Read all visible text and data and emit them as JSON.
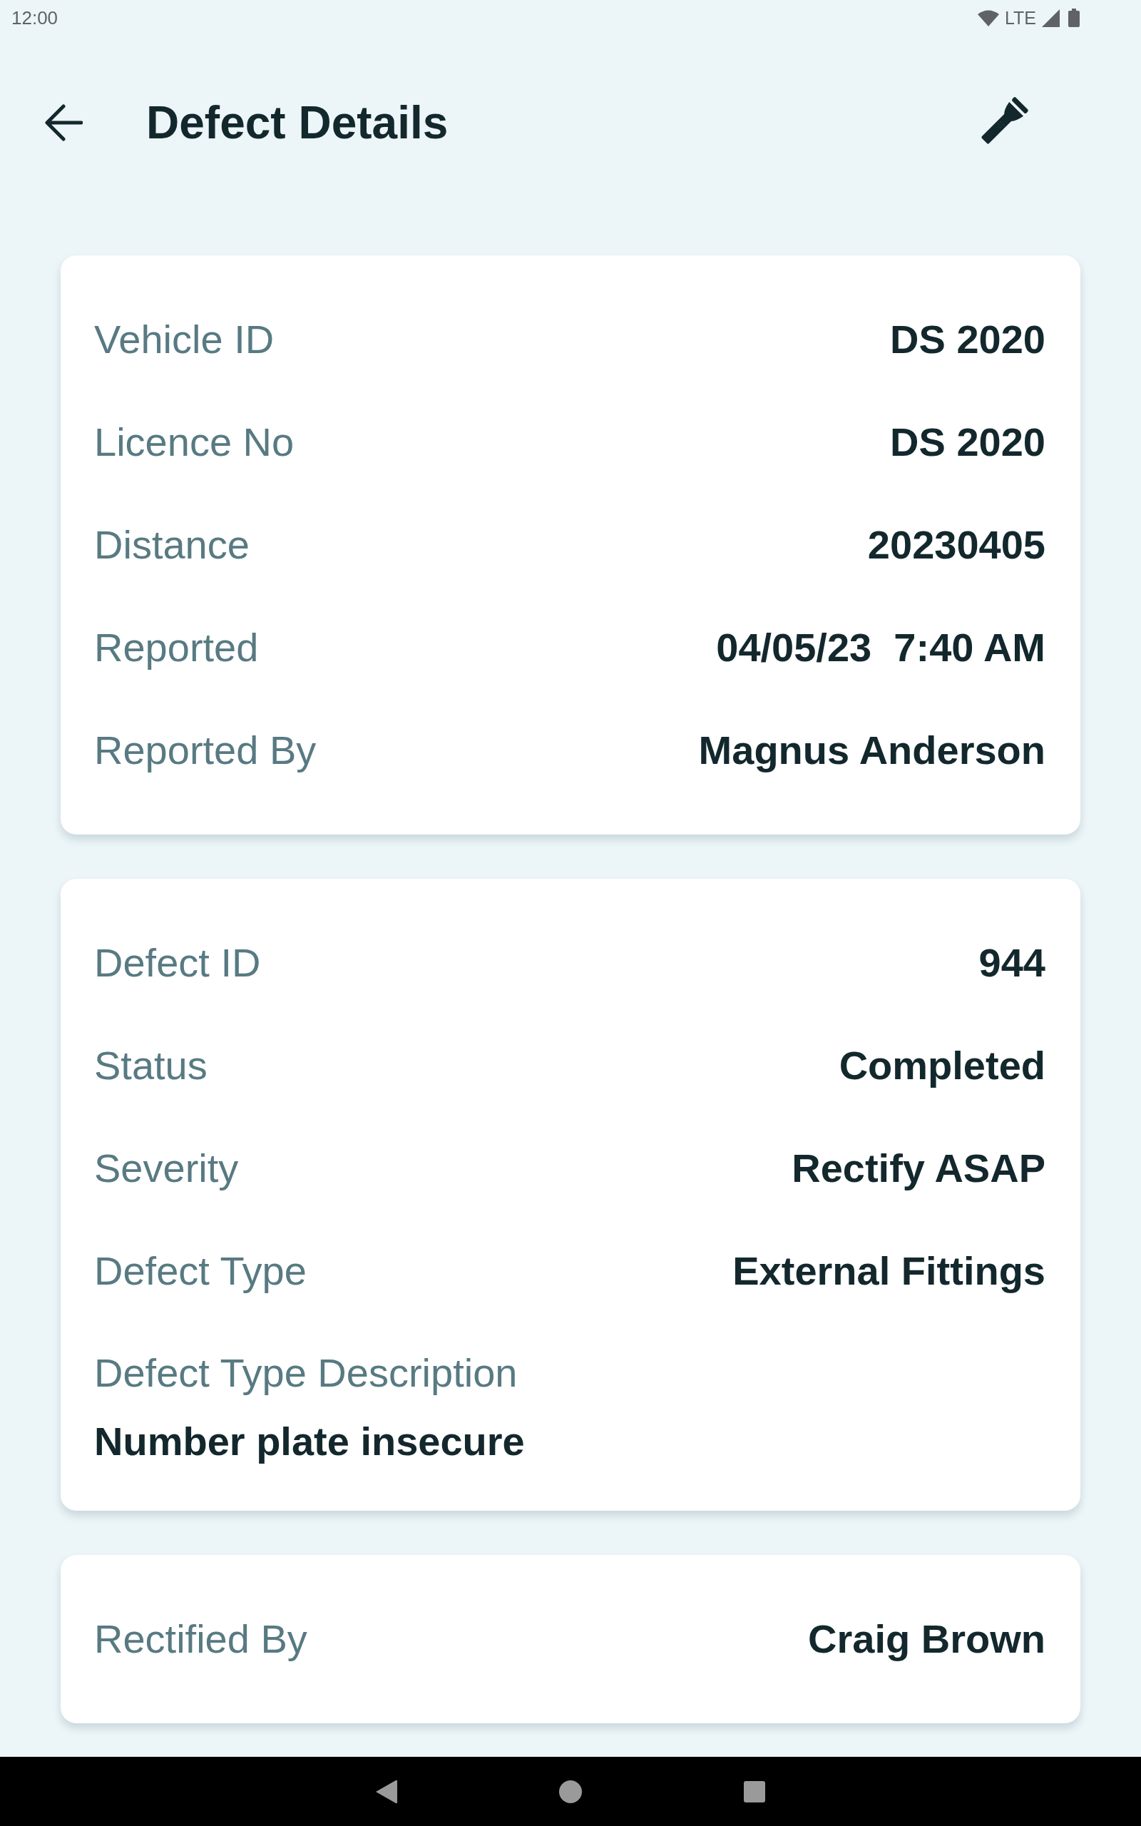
{
  "status_bar": {
    "time": "12:00",
    "network": "LTE"
  },
  "app_bar": {
    "title": "Defect Details"
  },
  "cards": [
    {
      "rows": [
        {
          "kind": "inline",
          "label": "Vehicle ID",
          "value": "DS 2020"
        },
        {
          "kind": "inline",
          "label": "Licence No",
          "value": "DS 2020"
        },
        {
          "kind": "inline",
          "label": "Distance",
          "value": "20230405"
        },
        {
          "kind": "inline",
          "label": "Reported",
          "value": "04/05/23  7:40 AM"
        },
        {
          "kind": "inline",
          "label": "Reported By",
          "value": "Magnus Anderson"
        }
      ]
    },
    {
      "rows": [
        {
          "kind": "inline",
          "label": "Defect ID",
          "value": "944"
        },
        {
          "kind": "inline",
          "label": "Status",
          "value": "Completed"
        },
        {
          "kind": "inline",
          "label": "Severity",
          "value": "Rectify ASAP"
        },
        {
          "kind": "inline",
          "label": "Defect Type",
          "value": "External Fittings"
        },
        {
          "kind": "stacked",
          "label": "Defect Type Description",
          "value": "Number plate insecure"
        }
      ]
    },
    {
      "rows": [
        {
          "kind": "inline",
          "label": "Rectified By",
          "value": "Craig Brown"
        }
      ]
    }
  ]
}
